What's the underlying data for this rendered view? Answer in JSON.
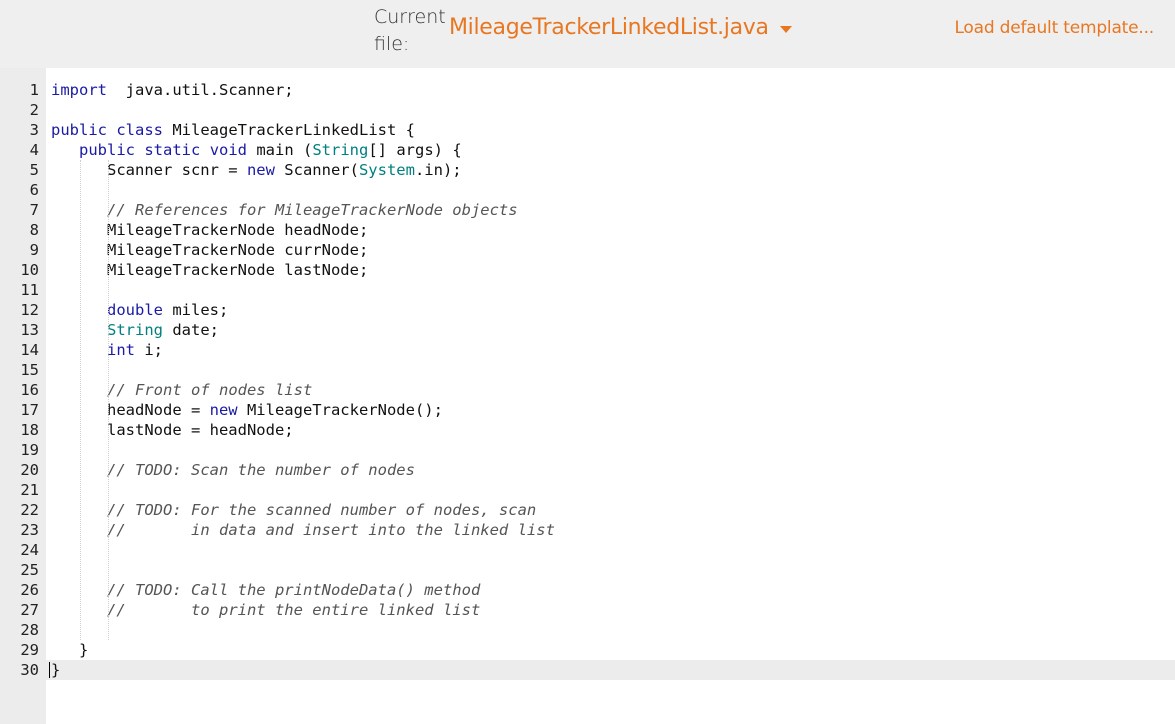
{
  "header": {
    "current_file_label_1": "Current",
    "current_file_label_2": "file:",
    "file_name": "MileageTrackerLinkedList.java",
    "load_default": "Load default template..."
  },
  "editor": {
    "active_line": 30,
    "lines": [
      {
        "n": "1",
        "code": [
          [
            "kw",
            "import"
          ],
          [
            "",
            "  java.util.Scanner;"
          ]
        ]
      },
      {
        "n": "2",
        "code": []
      },
      {
        "n": "3",
        "code": [
          [
            "kw",
            "public"
          ],
          [
            "",
            " "
          ],
          [
            "kw",
            "class"
          ],
          [
            "",
            " MileageTrackerLinkedList {"
          ]
        ]
      },
      {
        "n": "4",
        "code": [
          [
            "",
            "   "
          ],
          [
            "kw",
            "public"
          ],
          [
            "",
            " "
          ],
          [
            "kw",
            "static"
          ],
          [
            "",
            " "
          ],
          [
            "kw",
            "void"
          ],
          [
            "",
            " main ("
          ],
          [
            "ty",
            "String"
          ],
          [
            "",
            "[] args) {"
          ]
        ]
      },
      {
        "n": "5",
        "code": [
          [
            "",
            "      Scanner scnr = "
          ],
          [
            "kw",
            "new"
          ],
          [
            "",
            " Scanner("
          ],
          [
            "ty",
            "System"
          ],
          [
            "",
            ".in);"
          ]
        ]
      },
      {
        "n": "6",
        "code": []
      },
      {
        "n": "7",
        "code": [
          [
            "",
            "      "
          ],
          [
            "cm",
            "// References for MileageTrackerNode objects"
          ]
        ]
      },
      {
        "n": "8",
        "code": [
          [
            "",
            "      MileageTrackerNode headNode;"
          ]
        ]
      },
      {
        "n": "9",
        "code": [
          [
            "",
            "      MileageTrackerNode currNode;"
          ]
        ]
      },
      {
        "n": "10",
        "code": [
          [
            "",
            "      MileageTrackerNode lastNode;"
          ]
        ]
      },
      {
        "n": "11",
        "code": []
      },
      {
        "n": "12",
        "code": [
          [
            "",
            "      "
          ],
          [
            "kw",
            "double"
          ],
          [
            "",
            " miles;"
          ]
        ]
      },
      {
        "n": "13",
        "code": [
          [
            "",
            "      "
          ],
          [
            "ty",
            "String"
          ],
          [
            "",
            " date;"
          ]
        ]
      },
      {
        "n": "14",
        "code": [
          [
            "",
            "      "
          ],
          [
            "kw",
            "int"
          ],
          [
            "",
            " i;"
          ]
        ]
      },
      {
        "n": "15",
        "code": []
      },
      {
        "n": "16",
        "code": [
          [
            "",
            "      "
          ],
          [
            "cm",
            "// Front of nodes list"
          ]
        ]
      },
      {
        "n": "17",
        "code": [
          [
            "",
            "      headNode = "
          ],
          [
            "kw",
            "new"
          ],
          [
            "",
            " MileageTrackerNode();"
          ]
        ]
      },
      {
        "n": "18",
        "code": [
          [
            "",
            "      lastNode = headNode;"
          ]
        ]
      },
      {
        "n": "19",
        "code": []
      },
      {
        "n": "20",
        "code": [
          [
            "",
            "      "
          ],
          [
            "cm",
            "// TODO: Scan the number of nodes"
          ]
        ]
      },
      {
        "n": "21",
        "code": []
      },
      {
        "n": "22",
        "code": [
          [
            "",
            "      "
          ],
          [
            "cm",
            "// TODO: For the scanned number of nodes, scan"
          ]
        ]
      },
      {
        "n": "23",
        "code": [
          [
            "",
            "      "
          ],
          [
            "cm",
            "//       in data and insert into the linked list"
          ]
        ]
      },
      {
        "n": "24",
        "code": []
      },
      {
        "n": "25",
        "code": []
      },
      {
        "n": "26",
        "code": [
          [
            "",
            "      "
          ],
          [
            "cm",
            "// TODO: Call the printNodeData() method"
          ]
        ]
      },
      {
        "n": "27",
        "code": [
          [
            "",
            "      "
          ],
          [
            "cm",
            "//       to print the entire linked list"
          ]
        ]
      },
      {
        "n": "28",
        "code": []
      },
      {
        "n": "29",
        "code": [
          [
            "",
            "   }"
          ]
        ]
      },
      {
        "n": "30",
        "code": [
          [
            "",
            "}"
          ]
        ]
      }
    ]
  }
}
